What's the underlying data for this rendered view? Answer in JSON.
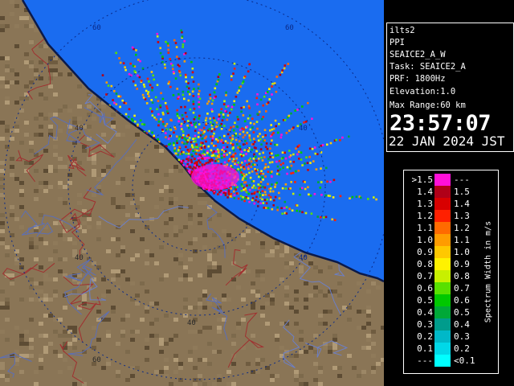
{
  "radar": {
    "range_labels": [
      "60",
      "40",
      "40",
      "40",
      "40",
      "40",
      "60",
      "60"
    ],
    "colors": {
      "sea": "#1a6cf0",
      "land": "#8a7556",
      "coast": "#0b1a4a",
      "rings": "#0a2a88"
    }
  },
  "info": {
    "site": "ilts2",
    "mode": "PPI",
    "scan": "SEAICE2_A_W",
    "task": "Task: SEAICE2_A",
    "prf": "PRF: 1800Hz",
    "elevation": "Elevation:1.0",
    "max_range": "Max Range:60 km",
    "time": "23:57:07",
    "date": "22 JAN 2024 JST"
  },
  "legend": {
    "unit": "Spectrum Width in m/s",
    "rows": [
      {
        "lo": ">1.5",
        "hi": "---",
        "color": "#ff10d8"
      },
      {
        "lo": "1.4",
        "hi": "1.5",
        "color": "#b00018"
      },
      {
        "lo": "1.3",
        "hi": "1.4",
        "color": "#d80000"
      },
      {
        "lo": "1.2",
        "hi": "1.3",
        "color": "#ff2000"
      },
      {
        "lo": "1.1",
        "hi": "1.2",
        "color": "#ff6a00"
      },
      {
        "lo": "1.0",
        "hi": "1.1",
        "color": "#ff9c00"
      },
      {
        "lo": "0.9",
        "hi": "1.0",
        "color": "#ffc800"
      },
      {
        "lo": "0.8",
        "hi": "0.9",
        "color": "#fff200"
      },
      {
        "lo": "0.7",
        "hi": "0.8",
        "color": "#c8f000"
      },
      {
        "lo": "0.6",
        "hi": "0.7",
        "color": "#58e000"
      },
      {
        "lo": "0.5",
        "hi": "0.6",
        "color": "#00c800"
      },
      {
        "lo": "0.4",
        "hi": "0.5",
        "color": "#00a838"
      },
      {
        "lo": "0.3",
        "hi": "0.4",
        "color": "#009c8c"
      },
      {
        "lo": "0.2",
        "hi": "0.3",
        "color": "#00b8c8"
      },
      {
        "lo": "0.1",
        "hi": "0.2",
        "color": "#00d8e8"
      },
      {
        "lo": "---",
        "hi": "<0.1",
        "color": "#00ffff"
      }
    ]
  }
}
